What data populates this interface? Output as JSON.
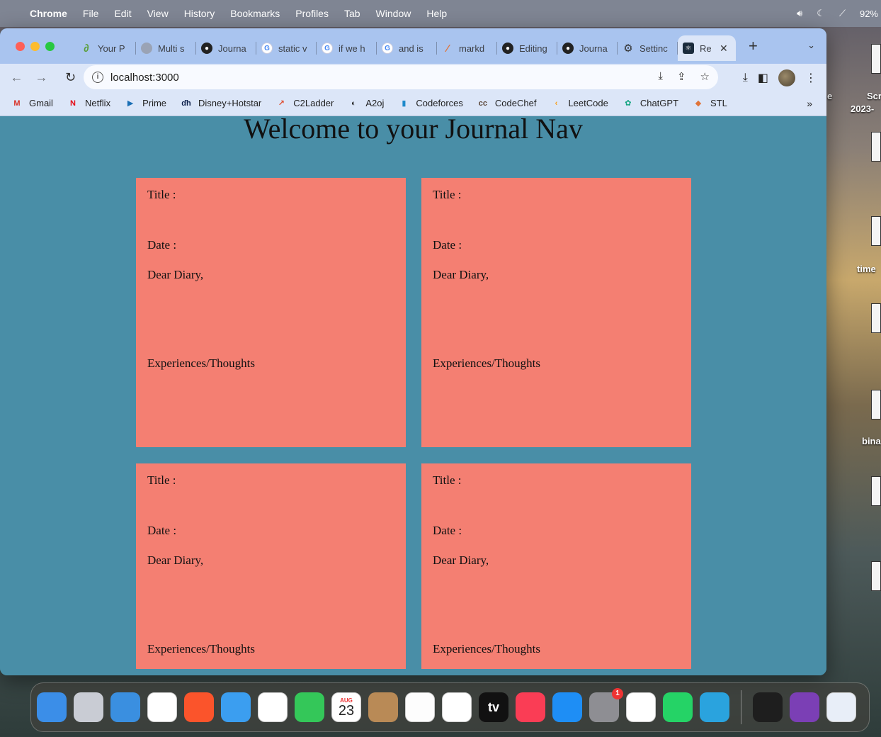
{
  "menubar": {
    "app": "Chrome",
    "items": [
      "File",
      "Edit",
      "View",
      "History",
      "Bookmarks",
      "Profiles",
      "Tab",
      "Window",
      "Help"
    ],
    "battery": "92%"
  },
  "desktop": {
    "labels": [
      "Scr",
      "2023-",
      "e",
      "time",
      "bina"
    ]
  },
  "tabs": [
    {
      "label": "Your P",
      "icon": "avocado-icon",
      "color": "#5a9f3a"
    },
    {
      "label": "Multi s",
      "icon": "globe-icon",
      "color": "#9aa3b5"
    },
    {
      "label": "Journa",
      "icon": "github-icon",
      "color": "#222222"
    },
    {
      "label": "static v",
      "icon": "google-icon",
      "color": "#4285f4"
    },
    {
      "label": "if we h",
      "icon": "google-icon",
      "color": "#4285f4"
    },
    {
      "label": "and is",
      "icon": "google-icon",
      "color": "#4285f4"
    },
    {
      "label": "markd",
      "icon": "marker-icon",
      "color": "#e0743a"
    },
    {
      "label": "Editing",
      "icon": "github-icon",
      "color": "#222222"
    },
    {
      "label": "Journa",
      "icon": "github-icon",
      "color": "#222222"
    },
    {
      "label": "Settinc",
      "icon": "gear-icon",
      "color": "#333333"
    }
  ],
  "active_tab": {
    "label": "Re",
    "icon": "react-icon"
  },
  "address_bar": {
    "url": "localhost:3000"
  },
  "bookmarks": [
    {
      "label": "Gmail",
      "icon": "gmail-icon",
      "glyph": "M",
      "color": "#d93025"
    },
    {
      "label": "Netflix",
      "icon": "netflix-icon",
      "glyph": "N",
      "color": "#e50914"
    },
    {
      "label": "Prime",
      "icon": "prime-icon",
      "glyph": "▶",
      "color": "#1a6fb5"
    },
    {
      "label": "Disney+Hotstar",
      "icon": "hotstar-icon",
      "glyph": "ɗh",
      "color": "#0c1f4a"
    },
    {
      "label": "C2Ladder",
      "icon": "ladder-icon",
      "glyph": "↗",
      "color": "#e04a2b"
    },
    {
      "label": "A2oj",
      "icon": "a2oj-icon",
      "glyph": "◐",
      "color": "#222222"
    },
    {
      "label": "Codeforces",
      "icon": "codeforces-icon",
      "glyph": "▮",
      "color": "#1f8acb"
    },
    {
      "label": "CodeChef",
      "icon": "codechef-icon",
      "glyph": "cc",
      "color": "#5b4638"
    },
    {
      "label": "LeetCode",
      "icon": "leetcode-icon",
      "glyph": "‹",
      "color": "#f89f1b"
    },
    {
      "label": "ChatGPT",
      "icon": "chatgpt-icon",
      "glyph": "✿",
      "color": "#10a37f"
    },
    {
      "label": "STL",
      "icon": "stl-icon",
      "glyph": "◆",
      "color": "#e0743a"
    }
  ],
  "page": {
    "title": "Welcome to your Journal Nav",
    "cards": [
      {
        "title": "Title :",
        "date": "Date :",
        "greeting": "Dear Diary,",
        "body": "Experiences/Thoughts"
      },
      {
        "title": "Title :",
        "date": "Date :",
        "greeting": "Dear Diary,",
        "body": "Experiences/Thoughts"
      },
      {
        "title": "Title :",
        "date": "Date :",
        "greeting": "Dear Diary,",
        "body": "Experiences/Thoughts"
      },
      {
        "title": "Title :",
        "date": "Date :",
        "greeting": "Dear Diary,",
        "body": "Experiences/Thoughts"
      }
    ]
  },
  "dock": {
    "apps": [
      {
        "name": "Finder",
        "icon": "finder-icon",
        "color": "#3b8ee8"
      },
      {
        "name": "Launchpad",
        "icon": "launchpad-icon",
        "color": "#c9ccd4"
      },
      {
        "name": "Safari",
        "icon": "safari-icon",
        "color": "#3a8fe0"
      },
      {
        "name": "Chrome",
        "icon": "chrome-icon",
        "color": "#ffffff"
      },
      {
        "name": "Brave",
        "icon": "brave-icon",
        "color": "#fb542b"
      },
      {
        "name": "Mail",
        "icon": "mail-icon",
        "color": "#3b9ef0"
      },
      {
        "name": "Photos",
        "icon": "photos-icon",
        "color": "#ffffff"
      },
      {
        "name": "FaceTime",
        "icon": "facetime-icon",
        "color": "#34c759"
      },
      {
        "name": "Calendar",
        "icon": "calendar-icon",
        "color": "#ffffff",
        "month": "AUG",
        "day": "23"
      },
      {
        "name": "Contacts",
        "icon": "contacts-icon",
        "color": "#b98a56"
      },
      {
        "name": "Notes",
        "icon": "notes-icon",
        "color": "#fdfdfd"
      },
      {
        "name": "Freeform",
        "icon": "freeform-icon",
        "color": "#ffffff"
      },
      {
        "name": "Apple TV",
        "icon": "appletv-icon",
        "color": "#111111",
        "text": "tv"
      },
      {
        "name": "Music",
        "icon": "music-icon",
        "color": "#fa3d55"
      },
      {
        "name": "App Store",
        "icon": "appstore-icon",
        "color": "#1e8ef5"
      },
      {
        "name": "System Settings",
        "icon": "settings-icon",
        "color": "#8e8e93",
        "badge": "1"
      },
      {
        "name": "VS Code",
        "icon": "vscode-icon",
        "color": "#ffffff"
      },
      {
        "name": "WhatsApp",
        "icon": "whatsapp-icon",
        "color": "#25d366"
      },
      {
        "name": "Telegram",
        "icon": "telegram-icon",
        "color": "#2aa3de"
      }
    ],
    "extras": [
      {
        "name": "Terminal",
        "icon": "terminal-icon",
        "color": "#1e1e1e"
      },
      {
        "name": "GitHub Desktop",
        "icon": "github-desktop-icon",
        "color": "#7b3fb5"
      },
      {
        "name": "Preview",
        "icon": "preview-icon",
        "color": "#e8eef8"
      }
    ]
  }
}
